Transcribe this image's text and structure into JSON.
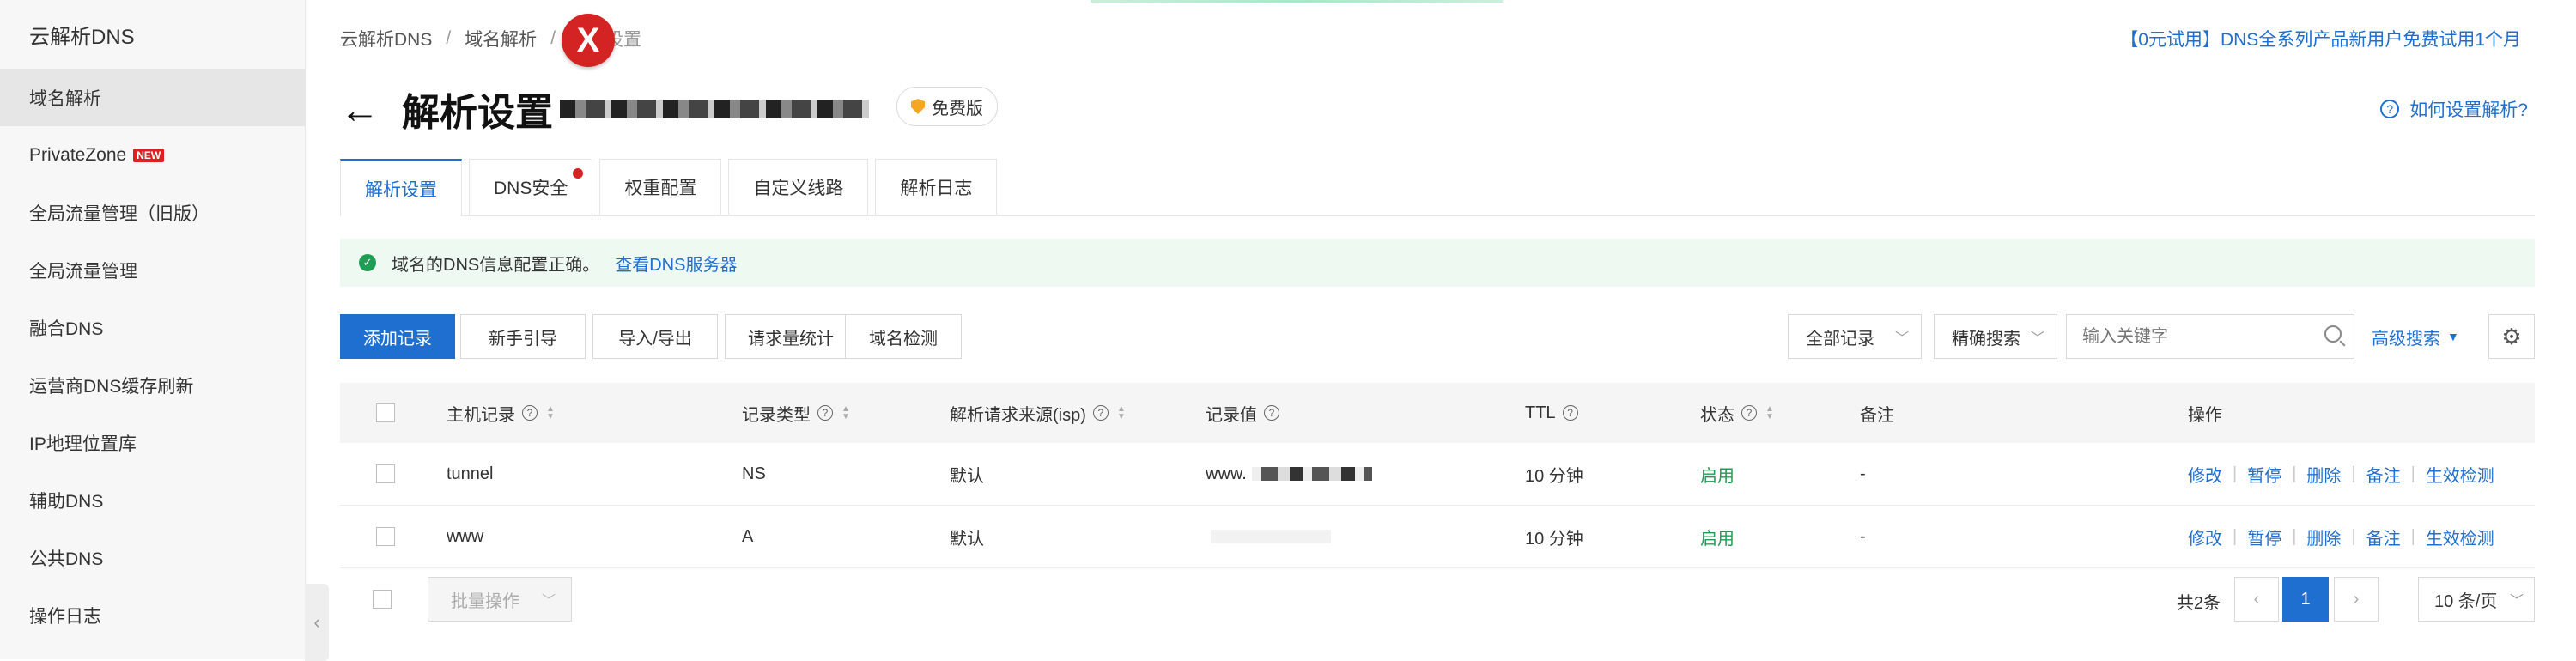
{
  "sidebar": {
    "title": "云解析DNS",
    "items": [
      {
        "label": "域名解析",
        "active": true
      },
      {
        "label": "PrivateZone",
        "badge": "NEW"
      },
      {
        "label": "全局流量管理（旧版）"
      },
      {
        "label": "全局流量管理"
      },
      {
        "label": "融合DNS"
      },
      {
        "label": "运营商DNS缓存刷新"
      },
      {
        "label": "IP地理位置库"
      },
      {
        "label": "辅助DNS"
      },
      {
        "label": "公共DNS"
      },
      {
        "label": "操作日志"
      }
    ]
  },
  "breadcrumb": [
    "云解析DNS",
    "域名解析",
    "解析设置"
  ],
  "promo": "【0元试用】DNS全系列产品新用户免费试用1个月",
  "page": {
    "title": "解析设置",
    "free_badge": "免费版",
    "help": "如何设置解析?"
  },
  "tabs": [
    {
      "label": "解析设置",
      "active": true
    },
    {
      "label": "DNS安全",
      "dot": true
    },
    {
      "label": "权重配置"
    },
    {
      "label": "自定义线路"
    },
    {
      "label": "解析日志"
    }
  ],
  "alert": {
    "text": "域名的DNS信息配置正确。",
    "link": "查看DNS服务器"
  },
  "toolbar": {
    "add": "添加记录",
    "guide": "新手引导",
    "import_export": "导入/导出",
    "stats": "请求量统计",
    "check": "域名检测",
    "filter": "全部记录",
    "match": "精确搜索",
    "search_placeholder": "输入关键字",
    "advanced": "高级搜索"
  },
  "table": {
    "headers": {
      "host": "主机记录",
      "type": "记录类型",
      "isp": "解析请求来源(isp)",
      "value": "记录值",
      "ttl": "TTL",
      "status": "状态",
      "remark": "备注",
      "ops": "操作"
    },
    "rows": [
      {
        "host": "tunnel",
        "type": "NS",
        "isp": "默认",
        "value": "www.",
        "ttl": "10 分钟",
        "status": "启用",
        "remark": "-"
      },
      {
        "host": "www",
        "type": "A",
        "isp": "默认",
        "value": "",
        "ttl": "10 分钟",
        "status": "启用",
        "remark": "-"
      }
    ],
    "ops": [
      "修改",
      "暂停",
      "删除",
      "备注",
      "生效检测"
    ]
  },
  "footer": {
    "batch": "批量操作",
    "total": "共2条",
    "page": "1",
    "page_size": "10 条/页"
  }
}
